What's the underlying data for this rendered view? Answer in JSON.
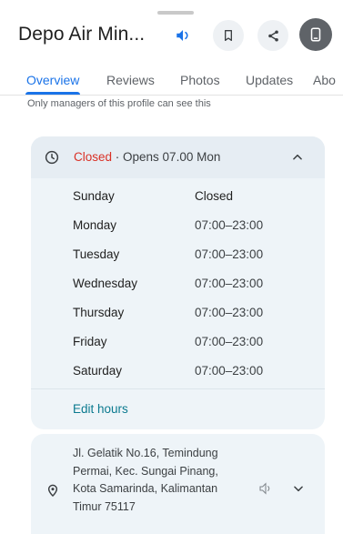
{
  "header": {
    "title": "Depo Air Min...",
    "speak_icon": "volume-icon",
    "save_icon": "bookmark-icon",
    "share_icon": "share-icon",
    "close_icon": "phone-icon"
  },
  "tabs": [
    {
      "label": "Overview",
      "active": true
    },
    {
      "label": "Reviews"
    },
    {
      "label": "Photos"
    },
    {
      "label": "Updates"
    },
    {
      "label": "Abo"
    }
  ],
  "cut_text": "Only managers of this profile can see this",
  "hours": {
    "status": "Closed",
    "status_suffix": " · Opens 07.00 Mon",
    "days": [
      {
        "day": "Sunday",
        "time": "Closed"
      },
      {
        "day": "Monday",
        "time": "07:00–23:00"
      },
      {
        "day": "Tuesday",
        "time": "07:00–23:00"
      },
      {
        "day": "Wednesday",
        "time": "07:00–23:00"
      },
      {
        "day": "Thursday",
        "time": "07:00–23:00"
      },
      {
        "day": "Friday",
        "time": "07:00–23:00"
      },
      {
        "day": "Saturday",
        "time": "07:00–23:00"
      }
    ],
    "edit_label": "Edit hours"
  },
  "address": {
    "lines": [
      "Jl. Gelatik No.16, Temindung",
      "Permai, Kec. Sungai Pinang,",
      "Kota Samarinda, Kalimantan",
      "Timur 75117"
    ]
  },
  "colors": {
    "accent": "#1a73e8",
    "closed": "#d93025",
    "link": "#0b7a8f",
    "card_bg": "#eef4f8"
  }
}
